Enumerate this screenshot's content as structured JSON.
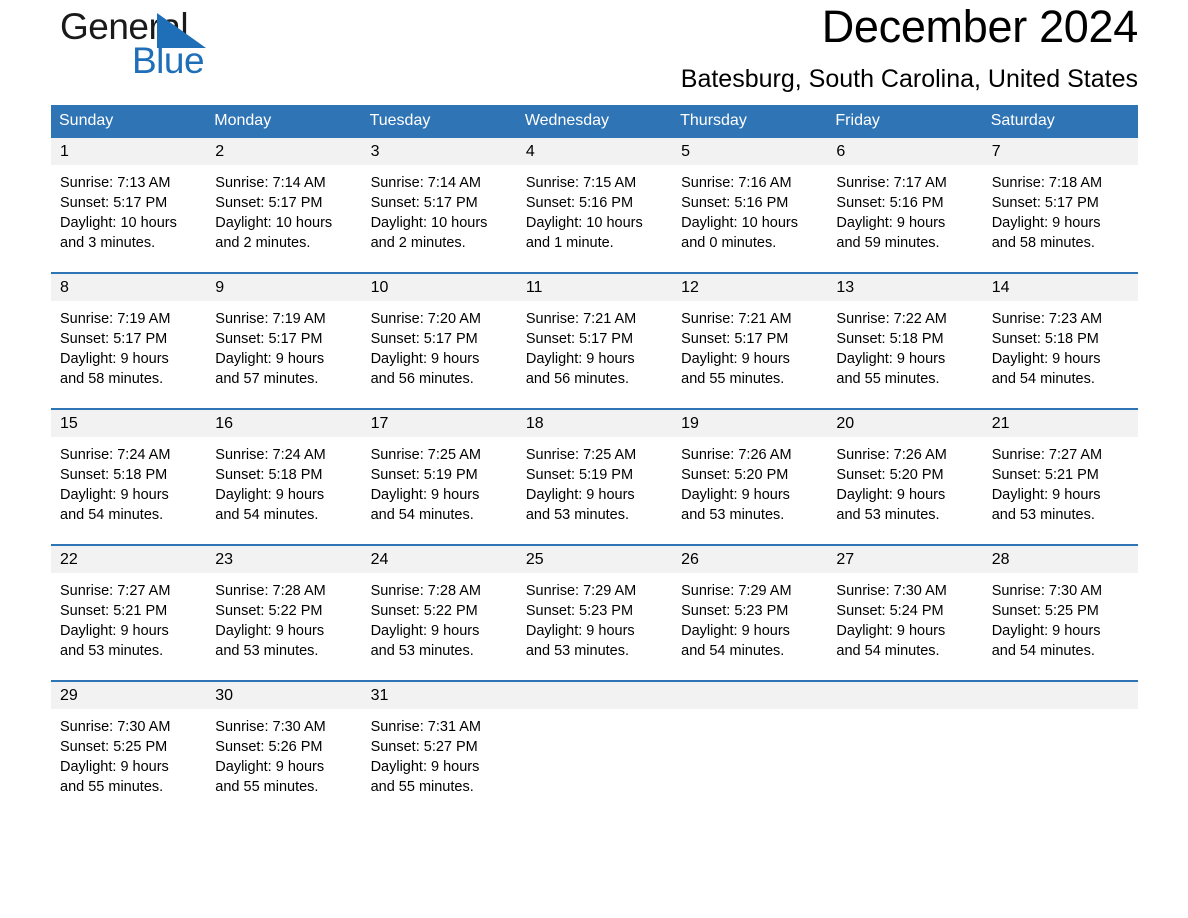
{
  "logo": {
    "word_one": "General",
    "word_two": "Blue",
    "triangle_color": "#1f6fb8",
    "text_color": "#1a1a1a"
  },
  "header": {
    "month_title": "December 2024",
    "location": "Batesburg, South Carolina, United States"
  },
  "theme": {
    "header_blue": "#2f74b5",
    "daynum_band": "#f2f2f2",
    "text": "#000000"
  },
  "weekdays": [
    "Sunday",
    "Monday",
    "Tuesday",
    "Wednesday",
    "Thursday",
    "Friday",
    "Saturday"
  ],
  "weeks": [
    {
      "days": [
        {
          "num": "1",
          "sunrise": "Sunrise: 7:13 AM",
          "sunset": "Sunset: 5:17 PM",
          "daylight_1": "Daylight: 10 hours",
          "daylight_2": "and 3 minutes."
        },
        {
          "num": "2",
          "sunrise": "Sunrise: 7:14 AM",
          "sunset": "Sunset: 5:17 PM",
          "daylight_1": "Daylight: 10 hours",
          "daylight_2": "and 2 minutes."
        },
        {
          "num": "3",
          "sunrise": "Sunrise: 7:14 AM",
          "sunset": "Sunset: 5:17 PM",
          "daylight_1": "Daylight: 10 hours",
          "daylight_2": "and 2 minutes."
        },
        {
          "num": "4",
          "sunrise": "Sunrise: 7:15 AM",
          "sunset": "Sunset: 5:16 PM",
          "daylight_1": "Daylight: 10 hours",
          "daylight_2": "and 1 minute."
        },
        {
          "num": "5",
          "sunrise": "Sunrise: 7:16 AM",
          "sunset": "Sunset: 5:16 PM",
          "daylight_1": "Daylight: 10 hours",
          "daylight_2": "and 0 minutes."
        },
        {
          "num": "6",
          "sunrise": "Sunrise: 7:17 AM",
          "sunset": "Sunset: 5:16 PM",
          "daylight_1": "Daylight: 9 hours",
          "daylight_2": "and 59 minutes."
        },
        {
          "num": "7",
          "sunrise": "Sunrise: 7:18 AM",
          "sunset": "Sunset: 5:17 PM",
          "daylight_1": "Daylight: 9 hours",
          "daylight_2": "and 58 minutes."
        }
      ]
    },
    {
      "days": [
        {
          "num": "8",
          "sunrise": "Sunrise: 7:19 AM",
          "sunset": "Sunset: 5:17 PM",
          "daylight_1": "Daylight: 9 hours",
          "daylight_2": "and 58 minutes."
        },
        {
          "num": "9",
          "sunrise": "Sunrise: 7:19 AM",
          "sunset": "Sunset: 5:17 PM",
          "daylight_1": "Daylight: 9 hours",
          "daylight_2": "and 57 minutes."
        },
        {
          "num": "10",
          "sunrise": "Sunrise: 7:20 AM",
          "sunset": "Sunset: 5:17 PM",
          "daylight_1": "Daylight: 9 hours",
          "daylight_2": "and 56 minutes."
        },
        {
          "num": "11",
          "sunrise": "Sunrise: 7:21 AM",
          "sunset": "Sunset: 5:17 PM",
          "daylight_1": "Daylight: 9 hours",
          "daylight_2": "and 56 minutes."
        },
        {
          "num": "12",
          "sunrise": "Sunrise: 7:21 AM",
          "sunset": "Sunset: 5:17 PM",
          "daylight_1": "Daylight: 9 hours",
          "daylight_2": "and 55 minutes."
        },
        {
          "num": "13",
          "sunrise": "Sunrise: 7:22 AM",
          "sunset": "Sunset: 5:18 PM",
          "daylight_1": "Daylight: 9 hours",
          "daylight_2": "and 55 minutes."
        },
        {
          "num": "14",
          "sunrise": "Sunrise: 7:23 AM",
          "sunset": "Sunset: 5:18 PM",
          "daylight_1": "Daylight: 9 hours",
          "daylight_2": "and 54 minutes."
        }
      ]
    },
    {
      "days": [
        {
          "num": "15",
          "sunrise": "Sunrise: 7:24 AM",
          "sunset": "Sunset: 5:18 PM",
          "daylight_1": "Daylight: 9 hours",
          "daylight_2": "and 54 minutes."
        },
        {
          "num": "16",
          "sunrise": "Sunrise: 7:24 AM",
          "sunset": "Sunset: 5:18 PM",
          "daylight_1": "Daylight: 9 hours",
          "daylight_2": "and 54 minutes."
        },
        {
          "num": "17",
          "sunrise": "Sunrise: 7:25 AM",
          "sunset": "Sunset: 5:19 PM",
          "daylight_1": "Daylight: 9 hours",
          "daylight_2": "and 54 minutes."
        },
        {
          "num": "18",
          "sunrise": "Sunrise: 7:25 AM",
          "sunset": "Sunset: 5:19 PM",
          "daylight_1": "Daylight: 9 hours",
          "daylight_2": "and 53 minutes."
        },
        {
          "num": "19",
          "sunrise": "Sunrise: 7:26 AM",
          "sunset": "Sunset: 5:20 PM",
          "daylight_1": "Daylight: 9 hours",
          "daylight_2": "and 53 minutes."
        },
        {
          "num": "20",
          "sunrise": "Sunrise: 7:26 AM",
          "sunset": "Sunset: 5:20 PM",
          "daylight_1": "Daylight: 9 hours",
          "daylight_2": "and 53 minutes."
        },
        {
          "num": "21",
          "sunrise": "Sunrise: 7:27 AM",
          "sunset": "Sunset: 5:21 PM",
          "daylight_1": "Daylight: 9 hours",
          "daylight_2": "and 53 minutes."
        }
      ]
    },
    {
      "days": [
        {
          "num": "22",
          "sunrise": "Sunrise: 7:27 AM",
          "sunset": "Sunset: 5:21 PM",
          "daylight_1": "Daylight: 9 hours",
          "daylight_2": "and 53 minutes."
        },
        {
          "num": "23",
          "sunrise": "Sunrise: 7:28 AM",
          "sunset": "Sunset: 5:22 PM",
          "daylight_1": "Daylight: 9 hours",
          "daylight_2": "and 53 minutes."
        },
        {
          "num": "24",
          "sunrise": "Sunrise: 7:28 AM",
          "sunset": "Sunset: 5:22 PM",
          "daylight_1": "Daylight: 9 hours",
          "daylight_2": "and 53 minutes."
        },
        {
          "num": "25",
          "sunrise": "Sunrise: 7:29 AM",
          "sunset": "Sunset: 5:23 PM",
          "daylight_1": "Daylight: 9 hours",
          "daylight_2": "and 53 minutes."
        },
        {
          "num": "26",
          "sunrise": "Sunrise: 7:29 AM",
          "sunset": "Sunset: 5:23 PM",
          "daylight_1": "Daylight: 9 hours",
          "daylight_2": "and 54 minutes."
        },
        {
          "num": "27",
          "sunrise": "Sunrise: 7:30 AM",
          "sunset": "Sunset: 5:24 PM",
          "daylight_1": "Daylight: 9 hours",
          "daylight_2": "and 54 minutes."
        },
        {
          "num": "28",
          "sunrise": "Sunrise: 7:30 AM",
          "sunset": "Sunset: 5:25 PM",
          "daylight_1": "Daylight: 9 hours",
          "daylight_2": "and 54 minutes."
        }
      ]
    },
    {
      "days": [
        {
          "num": "29",
          "sunrise": "Sunrise: 7:30 AM",
          "sunset": "Sunset: 5:25 PM",
          "daylight_1": "Daylight: 9 hours",
          "daylight_2": "and 55 minutes."
        },
        {
          "num": "30",
          "sunrise": "Sunrise: 7:30 AM",
          "sunset": "Sunset: 5:26 PM",
          "daylight_1": "Daylight: 9 hours",
          "daylight_2": "and 55 minutes."
        },
        {
          "num": "31",
          "sunrise": "Sunrise: 7:31 AM",
          "sunset": "Sunset: 5:27 PM",
          "daylight_1": "Daylight: 9 hours",
          "daylight_2": "and 55 minutes."
        },
        {
          "num": "",
          "sunrise": "",
          "sunset": "",
          "daylight_1": "",
          "daylight_2": ""
        },
        {
          "num": "",
          "sunrise": "",
          "sunset": "",
          "daylight_1": "",
          "daylight_2": ""
        },
        {
          "num": "",
          "sunrise": "",
          "sunset": "",
          "daylight_1": "",
          "daylight_2": ""
        },
        {
          "num": "",
          "sunrise": "",
          "sunset": "",
          "daylight_1": "",
          "daylight_2": ""
        }
      ]
    }
  ]
}
